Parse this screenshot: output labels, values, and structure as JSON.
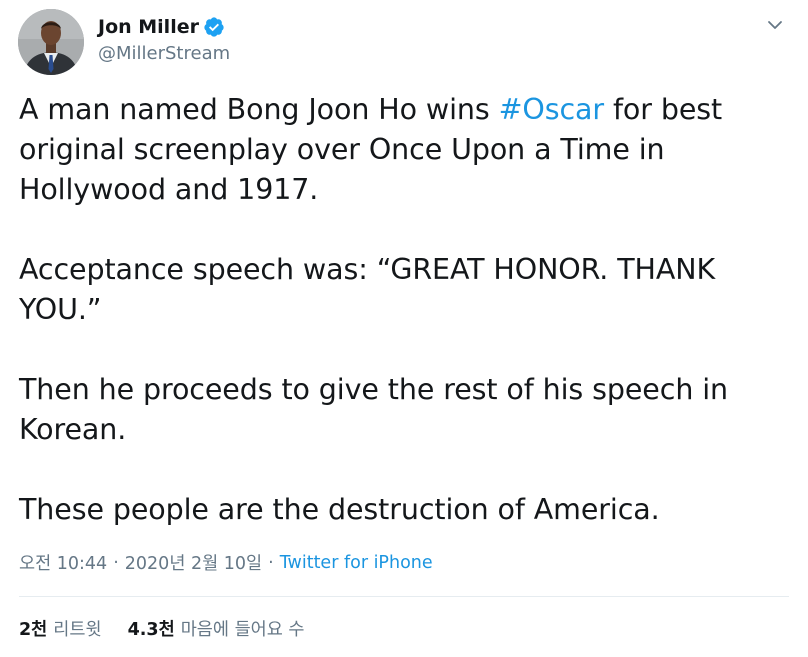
{
  "author": {
    "name": "Jon Miller",
    "handle": "@MillerStream",
    "verified": true
  },
  "tweet": {
    "paragraphs": [
      {
        "before": "A man named Bong Joon Ho wins ",
        "hashtag": "#Oscar",
        "after": " for best original screenplay over Once Upon a Time in Hollywood and 1917."
      },
      {
        "text": "Acceptance speech was: “GREAT HONOR. THANK YOU.”"
      },
      {
        "text": "Then he proceeds to give the rest of his speech in Korean."
      },
      {
        "text": "These people are the destruction of America."
      }
    ]
  },
  "meta": {
    "time": "오전 10:44",
    "date": "2020년 2월 10일",
    "separator": "·",
    "source": "Twitter for iPhone"
  },
  "stats": {
    "retweets": {
      "count": "2천",
      "label": "리트윗"
    },
    "likes": {
      "count": "4.3천",
      "label": "마음에 들어요 수"
    }
  },
  "colors": {
    "link": "#1b95e0",
    "muted": "#657786",
    "text": "#14171a",
    "verified": "#1da1f2"
  },
  "icons": {
    "verified": "verified-badge-icon",
    "menu": "chevron-down-icon"
  }
}
